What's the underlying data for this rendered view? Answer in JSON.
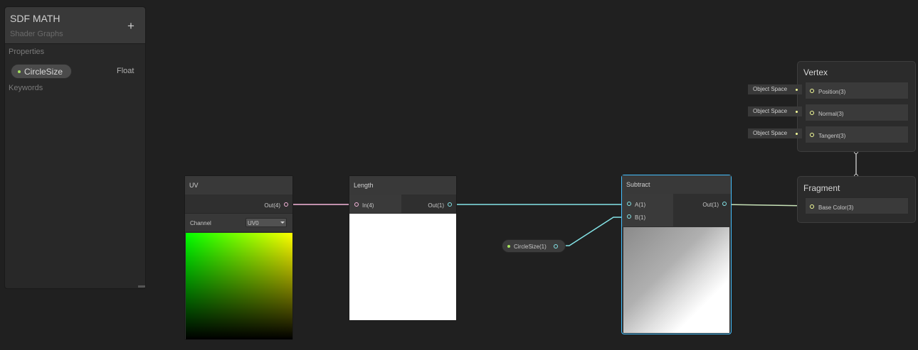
{
  "blackboard": {
    "title": "SDF MATH",
    "subtitle": "Shader Graphs",
    "add_label": "+",
    "properties_label": "Properties",
    "keywords_label": "Keywords",
    "properties": [
      {
        "name": "CircleSize",
        "type": "Float",
        "color": "#a6e25e"
      }
    ]
  },
  "nodes": {
    "uv": {
      "title": "UV",
      "output": "Out(4)",
      "channel_label": "Channel",
      "channel_value": "UV0"
    },
    "length": {
      "title": "Length",
      "input": "In(4)",
      "output": "Out(1)"
    },
    "circle_size": {
      "label": "CircleSize(1)"
    },
    "subtract": {
      "title": "Subtract",
      "input_a": "A(1)",
      "input_b": "B(1)",
      "output": "Out(1)"
    }
  },
  "master": {
    "vertex": {
      "title": "Vertex",
      "blocks": [
        {
          "label": "Position(3)",
          "space": "Object Space"
        },
        {
          "label": "Normal(3)",
          "space": "Object Space"
        },
        {
          "label": "Tangent(3)",
          "space": "Object Space"
        }
      ]
    },
    "fragment": {
      "title": "Fragment",
      "blocks": [
        {
          "label": "Base Color(3)"
        }
      ]
    }
  },
  "colors": {
    "vector4_port": "#f5b5db",
    "float_port": "#84e4e7",
    "vector3_port": "#f6ff9a",
    "selection": "#44c0ff"
  }
}
